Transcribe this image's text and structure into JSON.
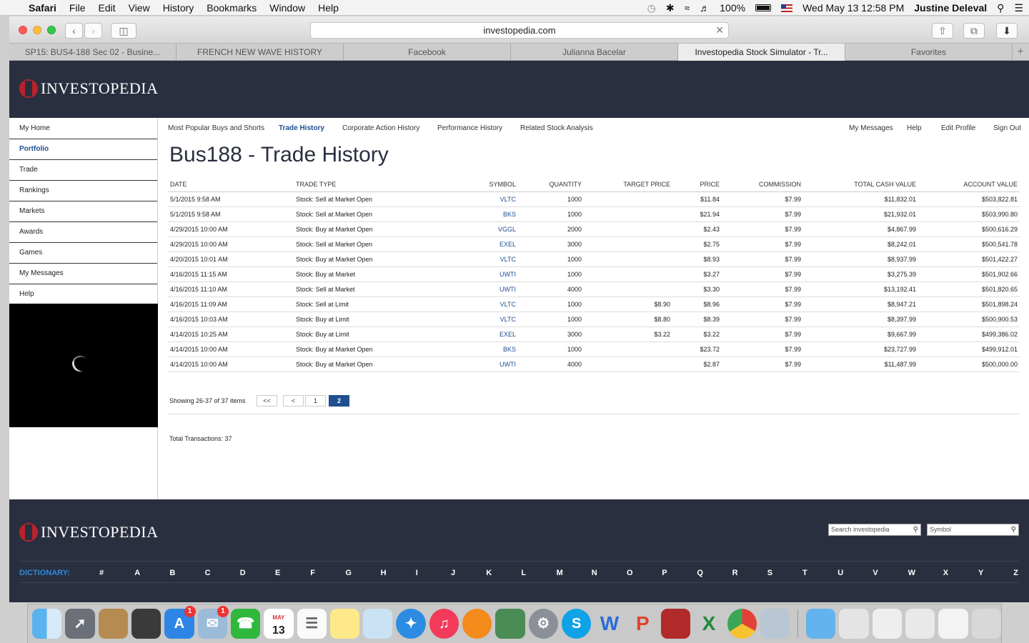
{
  "menubar": {
    "app": "Safari",
    "items": [
      "File",
      "Edit",
      "View",
      "History",
      "Bookmarks",
      "Window",
      "Help"
    ],
    "battery": "100%",
    "datetime": "Wed May 13  12:58 PM",
    "user": "Justine Deleval"
  },
  "browser": {
    "url": "investopedia.com",
    "tabs": [
      {
        "label": "SP15: BUS4-188 Sec 02 - Busine..."
      },
      {
        "label": "FRENCH NEW WAVE HISTORY"
      },
      {
        "label": "Facebook"
      },
      {
        "label": "Julianna Bacelar"
      },
      {
        "label": "Investopedia Stock Simulator - Tr..."
      },
      {
        "label": "Favorites"
      }
    ],
    "new_tab": "+"
  },
  "site": {
    "logo_text": "INVESTOPEDIA",
    "logo_letter": "I"
  },
  "sidebar": {
    "items": [
      {
        "label": "My Home"
      },
      {
        "label": "Portfolio"
      },
      {
        "label": "Trade"
      },
      {
        "label": "Rankings"
      },
      {
        "label": "Markets"
      },
      {
        "label": "Awards"
      },
      {
        "label": "Games"
      },
      {
        "label": "My Messages"
      },
      {
        "label": "Help"
      }
    ]
  },
  "subnav": {
    "left": [
      "Most Popular Buys and Shorts",
      "Trade History",
      "Corporate Action History",
      "Performance History",
      "Related Stock Analysis"
    ],
    "right": [
      "My Messages",
      "Help",
      "Edit Profile",
      "Sign Out"
    ]
  },
  "page_title": "Bus188 - Trade History",
  "table": {
    "headers": [
      "DATE",
      "TRADE TYPE",
      "SYMBOL",
      "QUANTITY",
      "TARGET PRICE",
      "PRICE",
      "COMMISSION",
      "TOTAL CASH VALUE",
      "ACCOUNT VALUE"
    ],
    "rows": [
      [
        "5/1/2015 9:58 AM",
        "Stock: Sell at Market Open",
        "VLTC",
        "1000",
        "",
        "$11.84",
        "$7.99",
        "$11,832.01",
        "$503,822.81"
      ],
      [
        "5/1/2015 9:58 AM",
        "Stock: Sell at Market Open",
        "BKS",
        "1000",
        "",
        "$21.94",
        "$7.99",
        "$21,932.01",
        "$503,990.80"
      ],
      [
        "4/29/2015 10:00 AM",
        "Stock: Buy at Market Open",
        "VGGL",
        "2000",
        "",
        "$2.43",
        "$7.99",
        "$4,867.99",
        "$500,616.29"
      ],
      [
        "4/29/2015 10:00 AM",
        "Stock: Sell at Market Open",
        "EXEL",
        "3000",
        "",
        "$2.75",
        "$7.99",
        "$8,242.01",
        "$500,541.78"
      ],
      [
        "4/20/2015 10:01 AM",
        "Stock: Buy at Market Open",
        "VLTC",
        "1000",
        "",
        "$8.93",
        "$7.99",
        "$8,937.99",
        "$501,422.27"
      ],
      [
        "4/16/2015 11:15 AM",
        "Stock: Buy at Market",
        "UWTI",
        "1000",
        "",
        "$3.27",
        "$7.99",
        "$3,275.39",
        "$501,902.66"
      ],
      [
        "4/16/2015 11:10 AM",
        "Stock: Sell at Market",
        "UWTI",
        "4000",
        "",
        "$3.30",
        "$7.99",
        "$13,192.41",
        "$501,820.65"
      ],
      [
        "4/16/2015 11:09 AM",
        "Stock: Sell at Limit",
        "VLTC",
        "1000",
        "$8.90",
        "$8.96",
        "$7.99",
        "$8,947.21",
        "$501,898.24"
      ],
      [
        "4/16/2015 10:03 AM",
        "Stock: Buy at Limit",
        "VLTC",
        "1000",
        "$8.80",
        "$8.39",
        "$7.99",
        "$8,397.99",
        "$500,900.53"
      ],
      [
        "4/14/2015 10:25 AM",
        "Stock: Buy at Limit",
        "EXEL",
        "3000",
        "$3.22",
        "$3.22",
        "$7.99",
        "$9,667.99",
        "$499,386.02"
      ],
      [
        "4/14/2015 10:00 AM",
        "Stock: Buy at Market Open",
        "BKS",
        "1000",
        "",
        "$23.72",
        "$7.99",
        "$23,727.99",
        "$499,912.01"
      ],
      [
        "4/14/2015 10:00 AM",
        "Stock: Buy at Market Open",
        "UWTI",
        "4000",
        "",
        "$2.87",
        "$7.99",
        "$11,487.99",
        "$500,000.00"
      ]
    ]
  },
  "pager": {
    "info": "Showing 26-37 of 37 items",
    "buttons": [
      "<<",
      "<",
      "1",
      "2"
    ],
    "current": "2"
  },
  "total_transactions": "Total Transactions: 37",
  "footer": {
    "search_placeholder": "Search investopedia",
    "symbol_placeholder": "Symbol",
    "dictionary_label": "DICTIONARY:",
    "letters": [
      "#",
      "A",
      "B",
      "C",
      "D",
      "E",
      "F",
      "G",
      "H",
      "I",
      "J",
      "K",
      "L",
      "M",
      "N",
      "O",
      "P",
      "Q",
      "R",
      "S",
      "T",
      "U",
      "V",
      "W",
      "X",
      "Y",
      "Z"
    ]
  },
  "dock": {
    "badge_appstore": "1",
    "badge_mail": "1",
    "calendar_month": "MAY",
    "calendar_day": "13"
  },
  "colors": {
    "header_bg": "#2a2f3f",
    "link_blue": "#1f4f8f",
    "logo_red": "#b8232b",
    "dictionary_blue": "#2d8ad8"
  }
}
